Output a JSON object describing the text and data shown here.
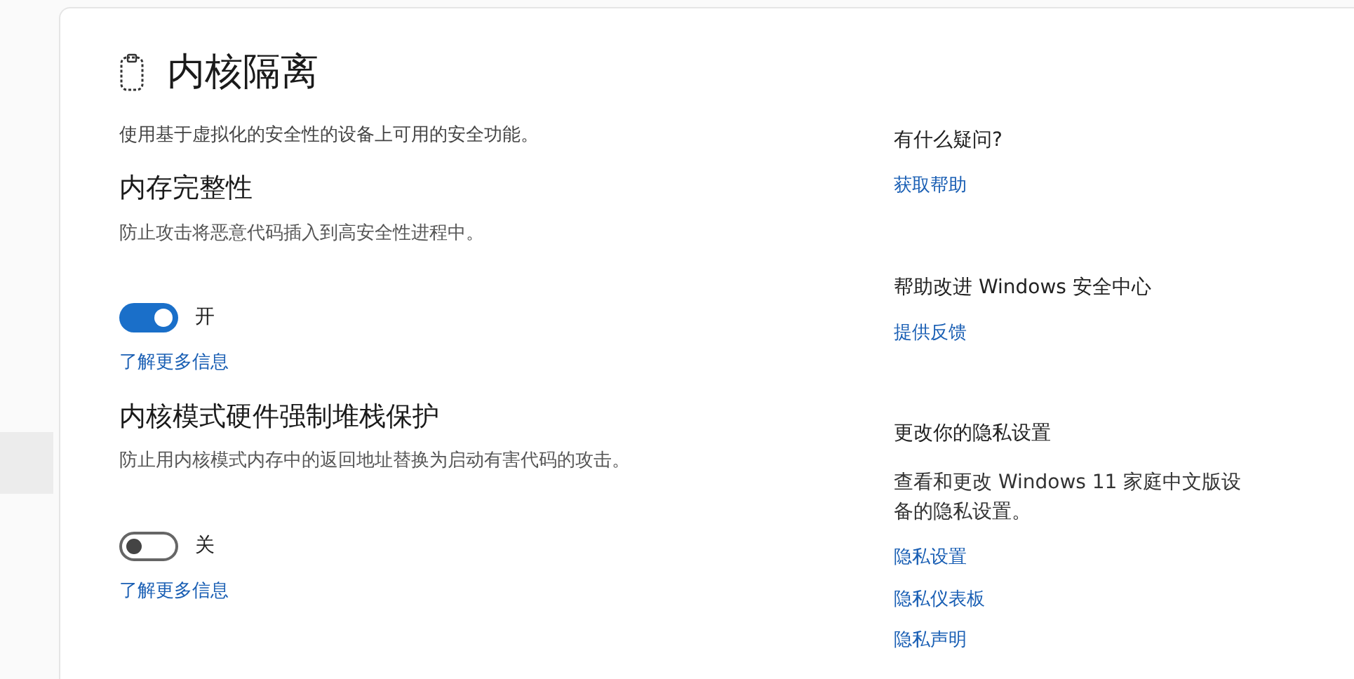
{
  "page": {
    "title": "内核隔离",
    "description": "使用基于虚拟化的安全性的设备上可用的安全功能。"
  },
  "sections": [
    {
      "title": "内存完整性",
      "description": "防止攻击将恶意代码插入到高安全性进程中。",
      "toggle": {
        "on": true,
        "label": "开"
      },
      "link": "了解更多信息"
    },
    {
      "title": "内核模式硬件强制堆栈保护",
      "description": "防止用内核模式内存中的返回地址替换为启动有害代码的攻击。",
      "toggle": {
        "on": false,
        "label": "关"
      },
      "link": "了解更多信息"
    }
  ],
  "side_panel": [
    {
      "heading": "有什么疑问?",
      "links": [
        "获取帮助"
      ]
    },
    {
      "heading": "帮助改进 Windows 安全中心",
      "links": [
        "提供反馈"
      ]
    },
    {
      "heading": "更改你的隐私设置",
      "text": "查看和更改 Windows 11 家庭中文版设备的隐私设置。",
      "links": [
        "隐私设置",
        "隐私仪表板",
        "隐私声明"
      ]
    }
  ]
}
